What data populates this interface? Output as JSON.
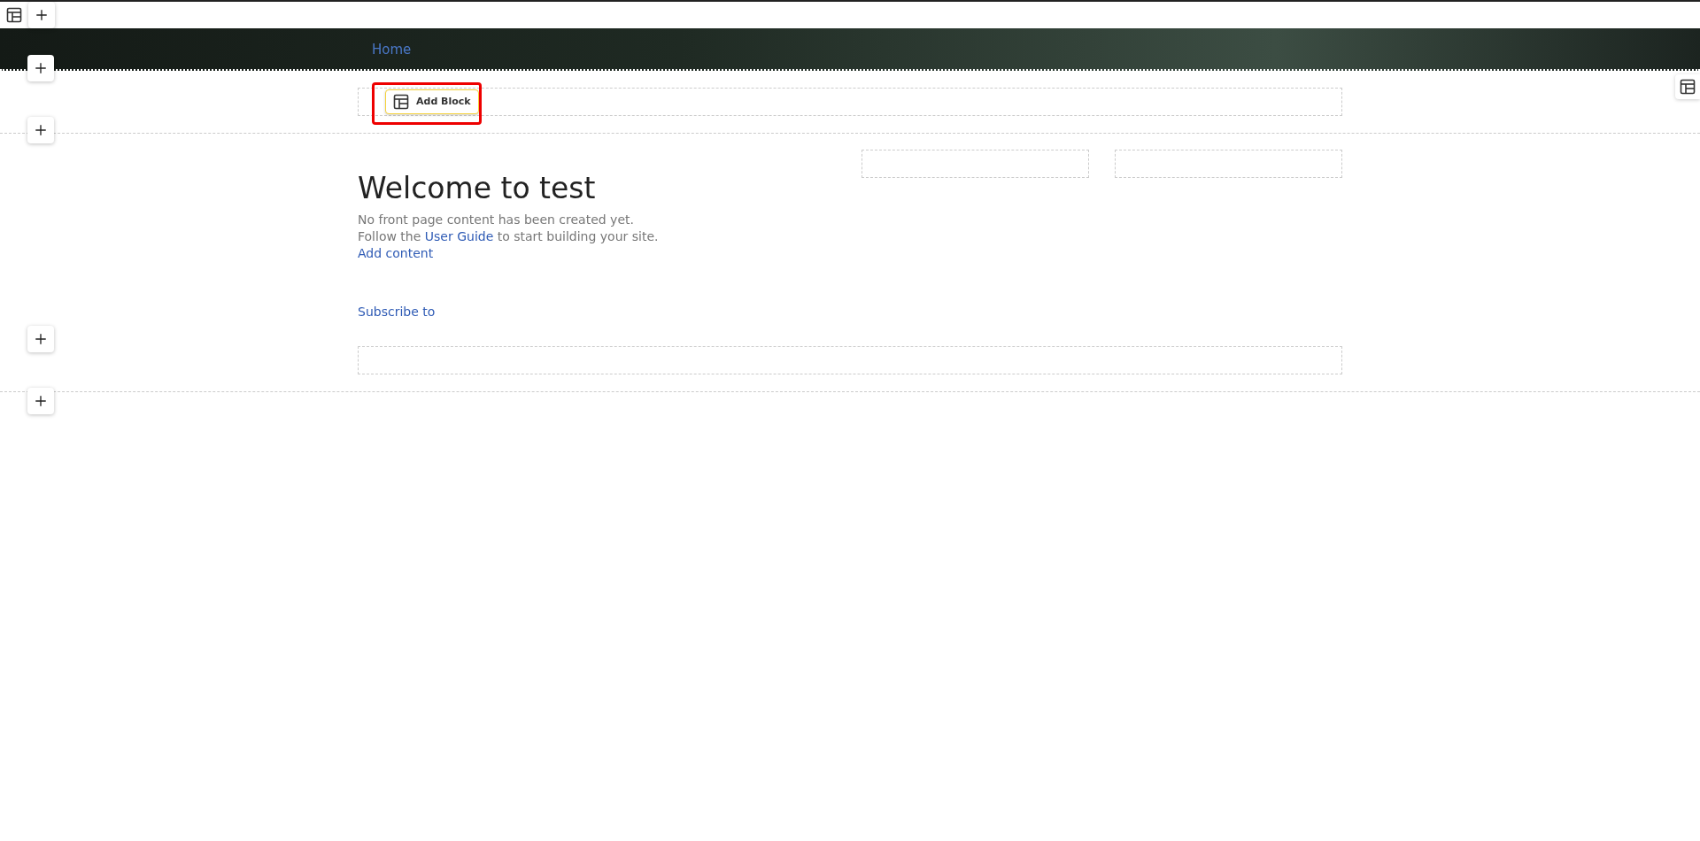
{
  "nav": [
    {
      "label": "Home"
    }
  ],
  "add_block": {
    "label": "Add Block"
  },
  "main": {
    "title": "Welcome to test",
    "intro": "No front page content has been created yet.",
    "guide": {
      "before": "Follow the ",
      "link": "User Guide",
      "after": " to start building your site."
    },
    "add_content": "Add content",
    "subscribe": "Subscribe to"
  }
}
